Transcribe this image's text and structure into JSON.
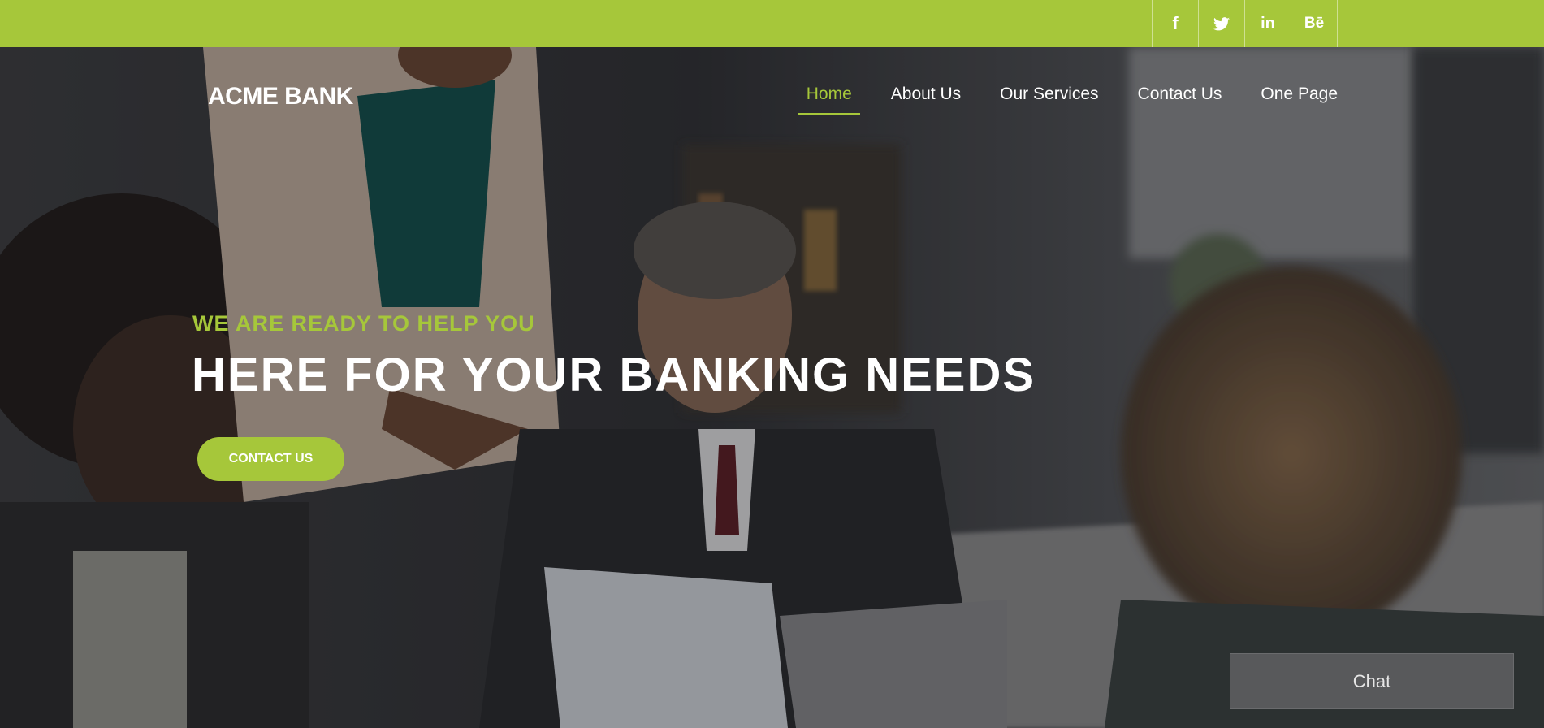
{
  "social": {
    "items": [
      {
        "icon": "facebook-icon",
        "label": "f"
      },
      {
        "icon": "twitter-icon",
        "label": ""
      },
      {
        "icon": "linkedin-icon",
        "label": "in"
      },
      {
        "icon": "behance-icon",
        "label": "Bē"
      }
    ]
  },
  "header": {
    "logo": "ACME BANK",
    "nav": [
      {
        "label": "Home",
        "active": true
      },
      {
        "label": "About Us",
        "active": false
      },
      {
        "label": "Our Services",
        "active": false
      },
      {
        "label": "Contact Us",
        "active": false
      },
      {
        "label": "One Page",
        "active": false
      }
    ]
  },
  "hero": {
    "tagline": "WE ARE READY TO HELP YOU",
    "headline": "HERE FOR YOUR BANKING NEEDS",
    "cta_label": "CONTACT US"
  },
  "chat": {
    "label": "Chat"
  },
  "colors": {
    "accent": "#a6c73a",
    "text_light": "#ffffff",
    "chat_bg": "#58595b"
  }
}
